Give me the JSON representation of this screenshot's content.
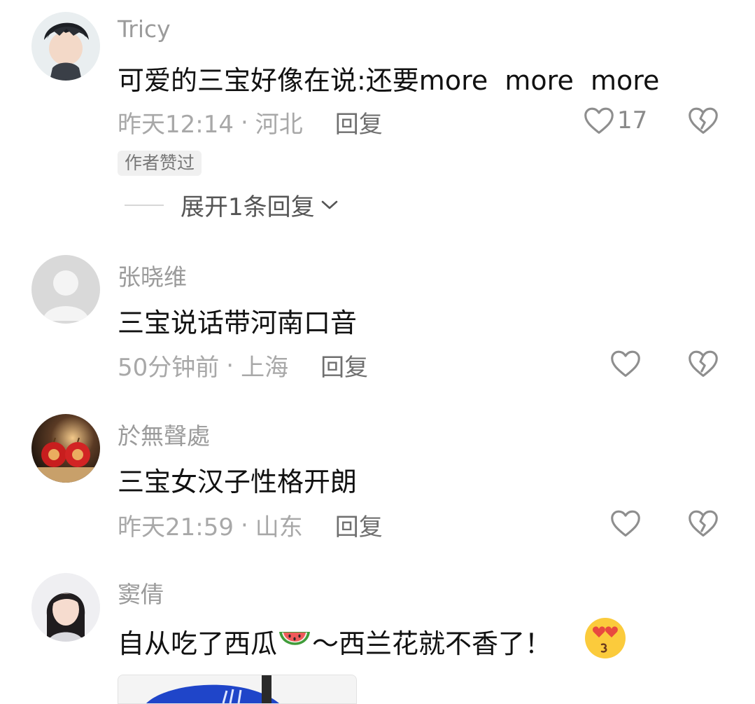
{
  "comments": [
    {
      "username": "Tricy",
      "content": "可爱的三宝好像在说:还要more  more  more",
      "time": "昨天12:14",
      "separator": "·",
      "location": "河北",
      "reply_label": "回复",
      "like_count": "17",
      "badge": "作者赞过",
      "expand_label": "展开1条回复",
      "avatar_icon": "young-man-avatar"
    },
    {
      "username": "张晓维",
      "content": "三宝说话带河南口音",
      "time": "50分钟前",
      "separator": "·",
      "location": "上海",
      "reply_label": "回复",
      "avatar_icon": "default-user-avatar"
    },
    {
      "username": "於無聲處",
      "content": "三宝女汉子性格开朗",
      "time": "昨天21:59",
      "separator": "·",
      "location": "山东",
      "reply_label": "回复",
      "avatar_icon": "red-apples-avatar"
    },
    {
      "username": "窦倩",
      "content_before": "自从吃了西瓜",
      "content_after": "～西兰花就不香了！",
      "avatar_icon": "young-woman-avatar"
    }
  ],
  "colors": {
    "accent_red": "#e8493f",
    "icon_gray": "#8e8e8e"
  }
}
